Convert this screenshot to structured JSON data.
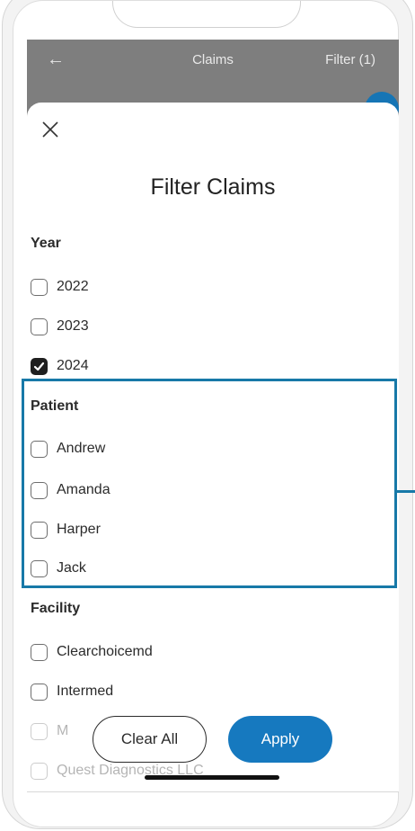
{
  "header": {
    "back_icon": "arrow-left-icon",
    "title": "Claims",
    "filter_label": "Filter (1)"
  },
  "sheet": {
    "close_icon": "close-icon",
    "title": "Filter Claims"
  },
  "sections": {
    "year": {
      "heading": "Year",
      "options": [
        {
          "label": "2022",
          "checked": false
        },
        {
          "label": "2023",
          "checked": false
        },
        {
          "label": "2024",
          "checked": true
        }
      ]
    },
    "patient": {
      "heading": "Patient",
      "options": [
        {
          "label": "Andrew",
          "checked": false
        },
        {
          "label": "Amanda",
          "checked": false
        },
        {
          "label": "Harper",
          "checked": false
        },
        {
          "label": "Jack",
          "checked": false
        }
      ]
    },
    "facility": {
      "heading": "Facility",
      "options": [
        {
          "label": "Clearchoicemd",
          "checked": false
        },
        {
          "label": "Intermed",
          "checked": false
        },
        {
          "label": "M",
          "checked": false
        },
        {
          "label": "Quest Diagnostics LLC",
          "checked": false
        }
      ]
    }
  },
  "footer": {
    "clear_label": "Clear All",
    "apply_label": "Apply"
  },
  "colors": {
    "accent": "#1679bf",
    "highlight": "#1779a8"
  }
}
